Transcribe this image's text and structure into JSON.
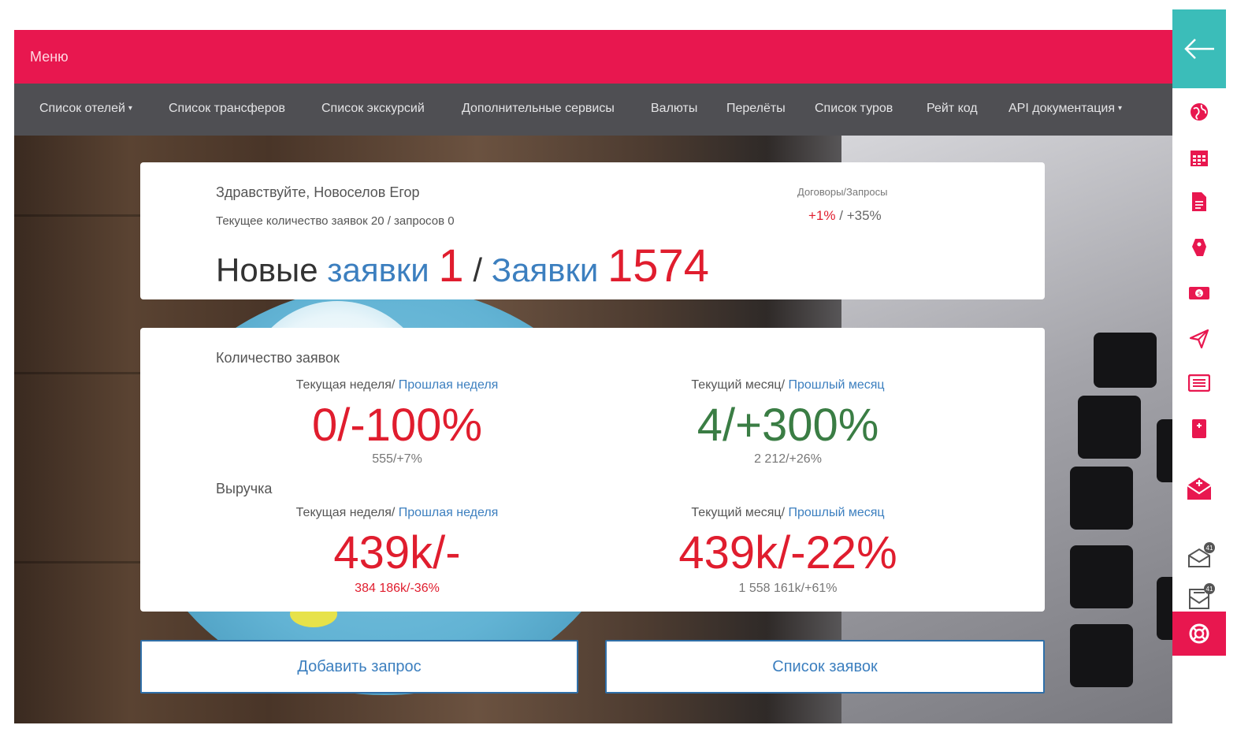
{
  "topbar": {
    "menu_label": "Меню"
  },
  "nav": [
    {
      "label": "Список отелей",
      "dropdown": true
    },
    {
      "label": "Список трансферов",
      "dropdown": false
    },
    {
      "label": "Список экскурсий",
      "dropdown": false
    },
    {
      "label": "Дополнительные сервисы",
      "dropdown": false
    },
    {
      "label": "Валюты",
      "dropdown": false
    },
    {
      "label": "Перелёты",
      "dropdown": false
    },
    {
      "label": "Список туров",
      "dropdown": false
    },
    {
      "label": "Рейт код",
      "dropdown": false
    },
    {
      "label": "API документация",
      "dropdown": true
    }
  ],
  "summary": {
    "greeting": "Здравствуйте, Новоселов Егор",
    "current_count": "Текущее количество заявок 20 / запросов 0",
    "new_word": "Новые",
    "requests_word": "заявки",
    "new_count": "1",
    "separator": "/",
    "all_requests_word": "Заявки",
    "all_count": "1574",
    "contracts_label": "Договоры/Запросы",
    "contracts_pct": "+1%",
    "contracts_sep": "/",
    "requests_pct": "+35%"
  },
  "stats": {
    "count_label": "Количество заявок",
    "revenue_label": "Выручка",
    "week_current": "Текущая неделя/",
    "week_prev": "Прошлая неделя",
    "month_current": "Текущий месяц/",
    "month_prev": "Прошлый месяц",
    "count_week_big": "0/-100%",
    "count_week_small": "555/+7%",
    "count_month_big": "4/+300%",
    "count_month_small": "2 212/+26%",
    "rev_week_big": "439k/-",
    "rev_week_small": "384 186k/-36%",
    "rev_month_big": "439k/-22%",
    "rev_month_small": "1 558 161k/+61%"
  },
  "buttons": {
    "add_request": "Добавить запрос",
    "request_list": "Список заявок"
  },
  "right_sidebar": {
    "icons": [
      "globe-icon",
      "calendar-icon",
      "document-icon",
      "tag-icon",
      "money-icon",
      "plane-icon",
      "catalog-icon",
      "book-icon",
      "mail-add-icon",
      "mail-outbox-icon",
      "mail-inbox-icon",
      "lifebuoy-icon"
    ],
    "badge_1": "41",
    "badge_2": "41"
  },
  "colors": {
    "brand": "#e8174f",
    "nav": "#4f4f53",
    "link": "#3c7fbf",
    "negative": "#e01d2e",
    "positive": "#3a7d44",
    "sidebar_back": "#3bbdb9"
  }
}
